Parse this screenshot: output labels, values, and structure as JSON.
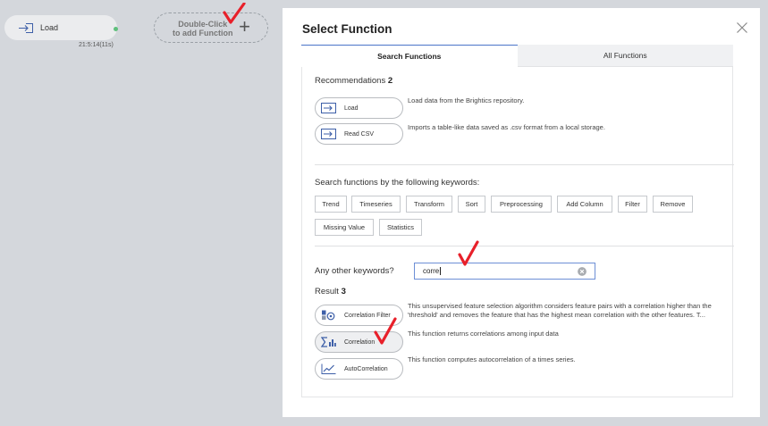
{
  "canvas": {
    "load_node": {
      "label": "Load",
      "time": "21:5:14(11s)",
      "icon": "arrow-into-box-icon"
    },
    "add_node": {
      "line1": "Double-Click",
      "line2": "to add Function",
      "plus": "+"
    }
  },
  "modal": {
    "title": "Select Function",
    "tabs": [
      {
        "label": "Search Functions",
        "active": true
      },
      {
        "label": "All Functions",
        "active": false
      }
    ],
    "recommendations": {
      "label": "Recommendations",
      "count": "2",
      "items": [
        {
          "label": "Load",
          "icon": "arrow-into-box-icon",
          "desc": "Load data from the Brightics repository."
        },
        {
          "label": "Read CSV",
          "icon": "arrow-into-box-icon",
          "desc": "Imports a table-like data saved as .csv format from a local storage."
        }
      ]
    },
    "keywords": {
      "label": "Search functions by the following keywords:",
      "items": [
        "Trend",
        "Timeseries",
        "Transform",
        "Sort",
        "Preprocessing",
        "Add Column",
        "Filter",
        "Remove",
        "Missing Value",
        "Statistics"
      ]
    },
    "other": {
      "label": "Any other keywords?",
      "value": "corre"
    },
    "result": {
      "label": "Result",
      "count": "3",
      "items": [
        {
          "label": "Correlation Filter",
          "icon": "correlation-filter-icon",
          "desc": "This unsupervised feature selection algorithm considers feature pairs with a correlation higher than the 'threshold' and removes the feature that has the highest mean correlation with the other features. T..."
        },
        {
          "label": "Correlation",
          "icon": "sigma-chart-icon",
          "desc": "This function returns correlations among input data"
        },
        {
          "label": "AutoCorrelation",
          "icon": "line-chart-icon",
          "desc": "This function computes autocorrelation of a times series."
        }
      ]
    }
  },
  "colors": {
    "accent": "#4a74c9",
    "check": "#e8202a",
    "status_dot": "#5fc07c",
    "background": "#d4d7dc"
  }
}
